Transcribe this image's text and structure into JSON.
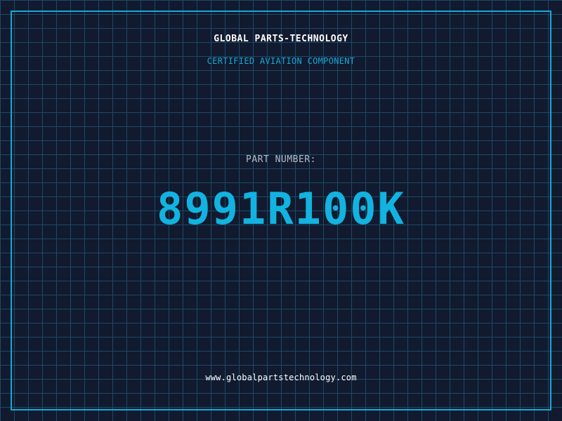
{
  "header": {
    "company_name": "GLOBAL PARTS-TECHNOLOGY",
    "subtitle": "CERTIFIED AVIATION COMPONENT"
  },
  "part": {
    "label": "PART NUMBER:",
    "number": "8991R100K"
  },
  "footer": {
    "url": "www.globalpartstechnology.com"
  },
  "colors": {
    "background": "#111a2f",
    "grid": "#1d4a66",
    "accent": "#16a9d6",
    "part_number": "#12b3e0",
    "label": "#b4bcc9",
    "text": "#ffffff"
  }
}
